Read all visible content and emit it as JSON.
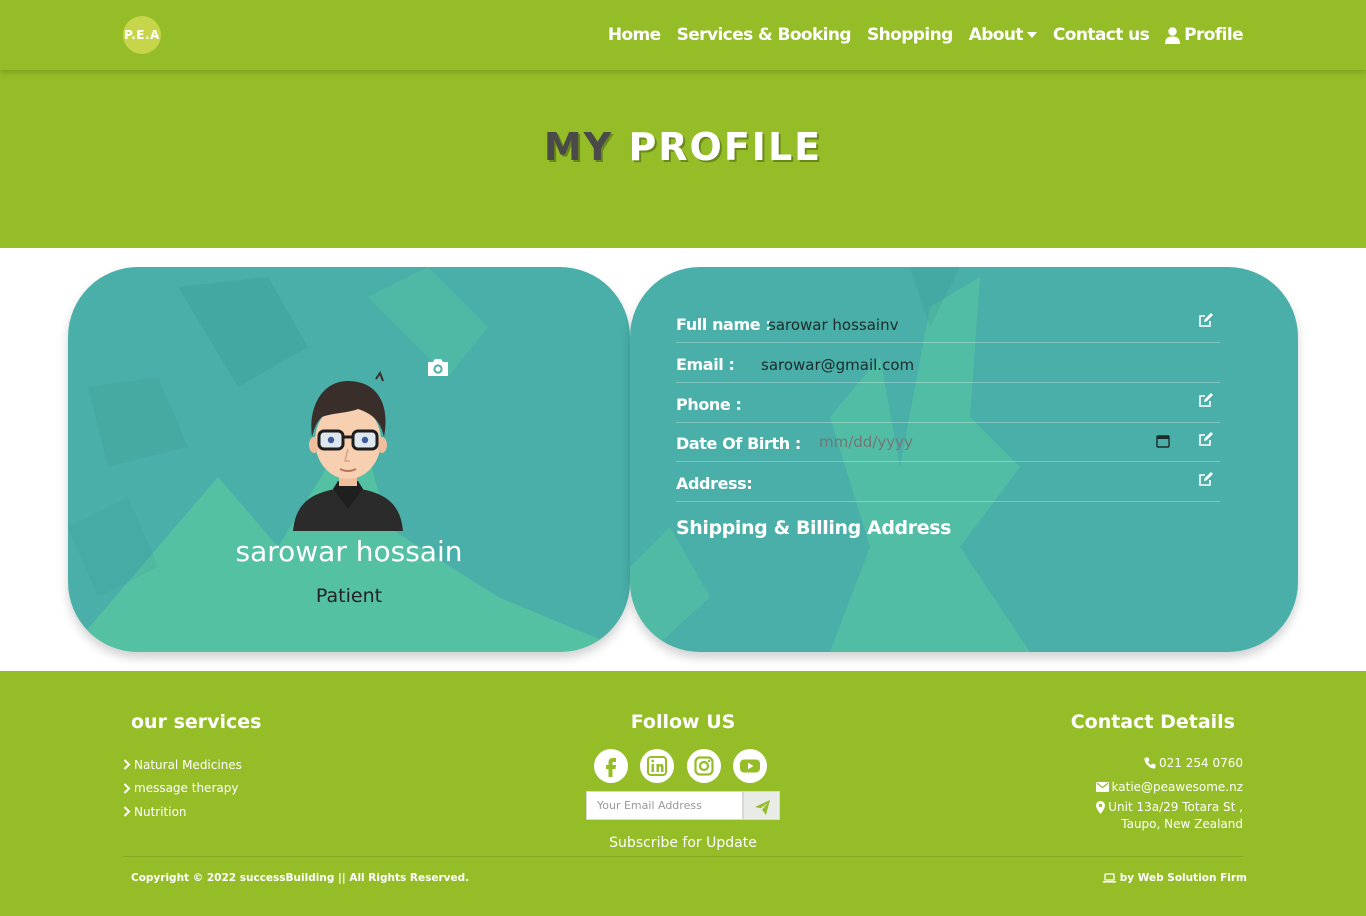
{
  "brand": {
    "logo_text": "P.E.A"
  },
  "nav": {
    "home": "Home",
    "services": "Services & Booking",
    "shopping": "Shopping",
    "about": "About",
    "contact": "Contact us",
    "profile": "Profile"
  },
  "hero": {
    "title_part1": "MY",
    "title_part2": "PROFILE"
  },
  "profile_card": {
    "name": "sarowar hossain",
    "role": "Patient"
  },
  "details": {
    "full_name_label": "Full name :",
    "full_name_value": "sarowar hossainv",
    "email_label": "Email :",
    "email_value": "sarowar@gmail.com",
    "phone_label": "Phone :",
    "phone_value": "",
    "dob_label": "Date Of Birth :",
    "dob_placeholder": "mm/dd/yyyy",
    "address_label": "Address:",
    "address_value": "",
    "shipping_title": "Shipping & Billing Address"
  },
  "footer": {
    "services_heading": "our services",
    "services": [
      "Natural Medicines",
      "message therapy",
      "Nutrition"
    ],
    "follow_heading": "Follow US",
    "email_placeholder": "Your Email Address",
    "subscribe_text": "Subscribe for Update",
    "contact_heading": "Contact Details",
    "phone": "021 254 0760",
    "email": "katie@peawesome.nz",
    "address_line1": "Unit 13a/29 Totara St ,",
    "address_line2": "Taupo, New Zealand",
    "copyright": "Copyright © 2022 successBuilding || All Rights Reserved.",
    "credit": "by Web Solution Firm"
  },
  "colors": {
    "primary_green": "#95bd27",
    "card_teal": "#4aafa9",
    "accent_mint": "#5ecf9f",
    "text_dark": "#4a4a4a"
  },
  "icons": [
    "camera-icon",
    "edit-icon",
    "calendar-icon",
    "user-icon",
    "caret-down-icon",
    "chevron-right-icon",
    "phone-icon",
    "envelope-icon",
    "map-marker-icon",
    "laptop-icon",
    "send-icon",
    "facebook-icon",
    "linkedin-icon",
    "instagram-icon",
    "youtube-icon"
  ]
}
